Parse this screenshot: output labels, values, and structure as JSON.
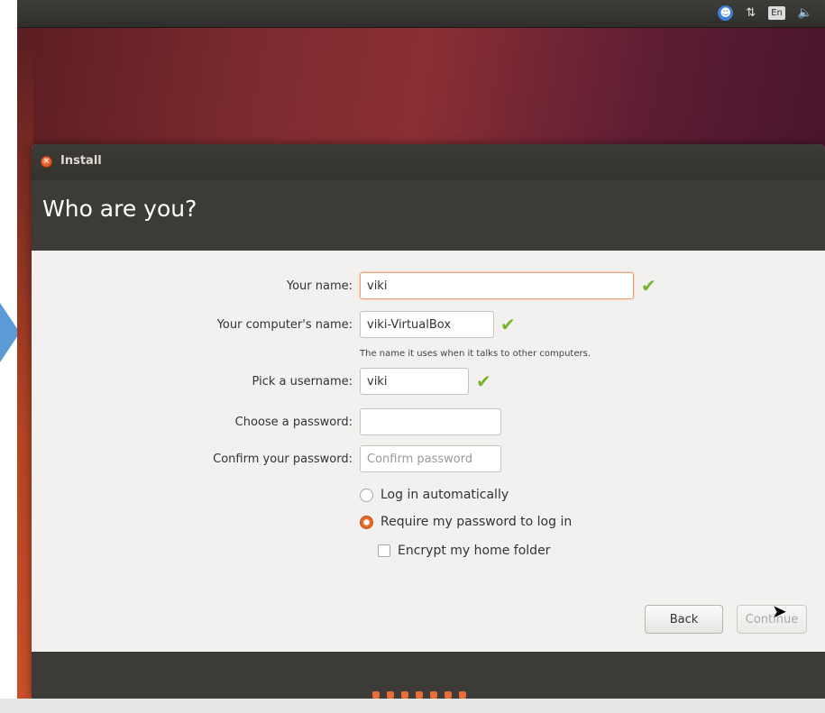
{
  "panel": {
    "lang": "En"
  },
  "window": {
    "title": "Install",
    "header": "Who are you?"
  },
  "form": {
    "name_label": "Your name:",
    "name_value": "viki",
    "computer_label": "Your computer's name:",
    "computer_value": "viki-VirtualBox",
    "computer_hint": "The name it uses when it talks to other computers.",
    "username_label": "Pick a username:",
    "username_value": "viki",
    "password_label": "Choose a password:",
    "password_value": "",
    "confirm_label": "Confirm your password:",
    "confirm_placeholder": "Confirm password",
    "login_auto": "Log in automatically",
    "login_require": "Require my password to log in",
    "encrypt": "Encrypt my home folder"
  },
  "buttons": {
    "back": "Back",
    "continue": "Continue"
  },
  "colors": {
    "accent": "#e56c2c",
    "check": "#7bb32e"
  }
}
